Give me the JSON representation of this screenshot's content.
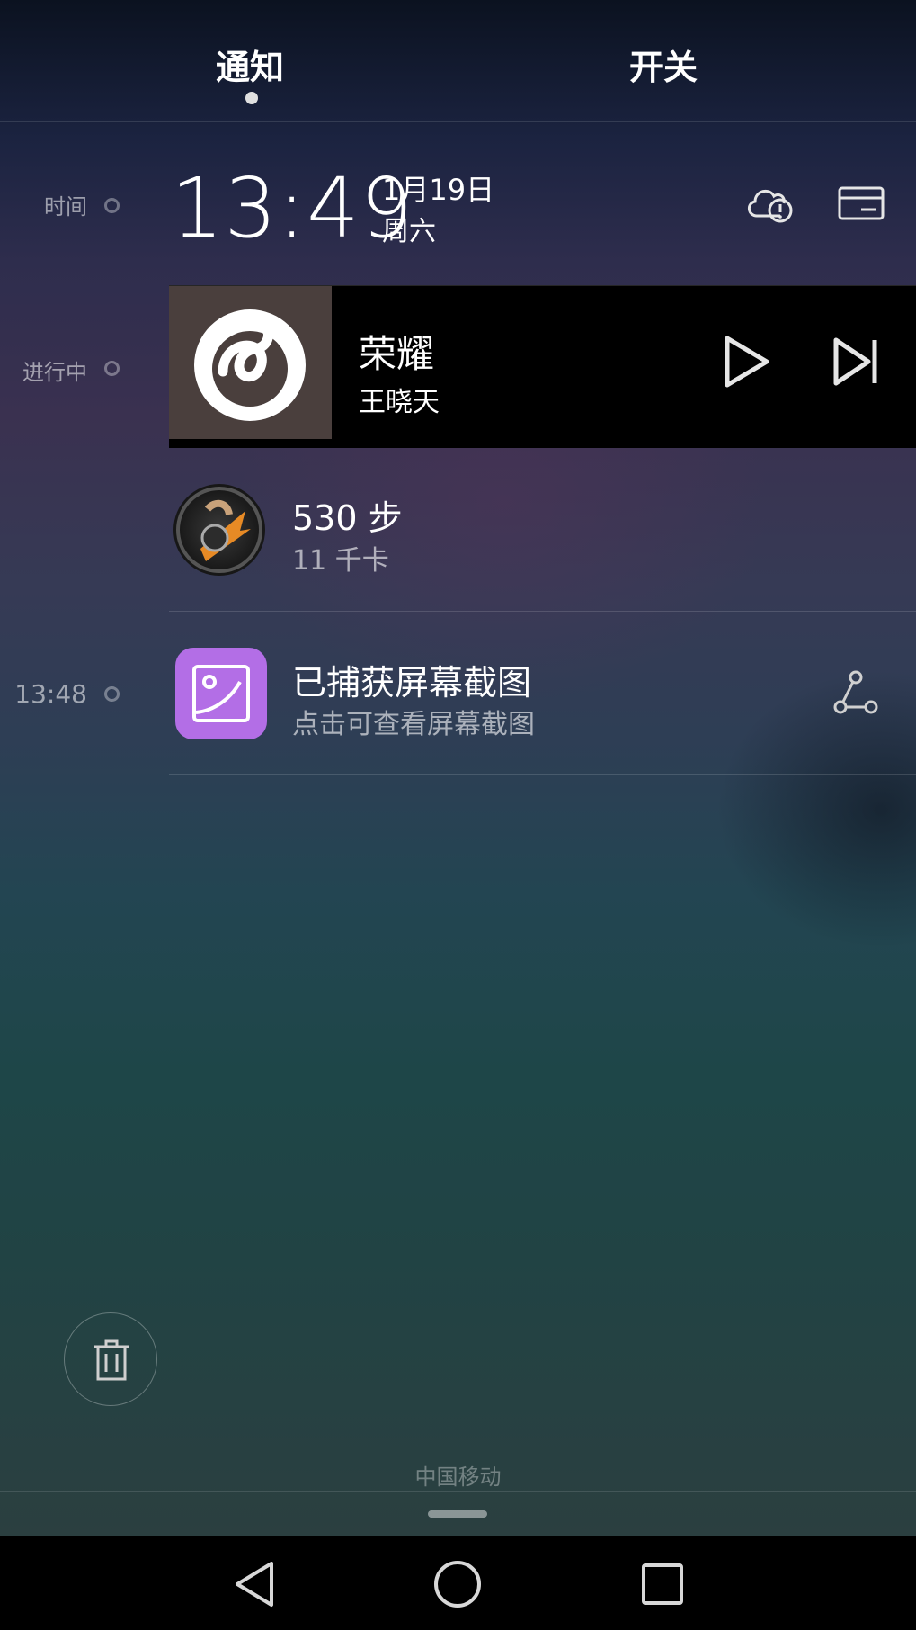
{
  "tabs": {
    "notifications": "通知",
    "switches": "开关"
  },
  "timeline": {
    "time_label": "时间",
    "ongoing_label": "进行中",
    "past_time": "13:48"
  },
  "clock": {
    "time": "13:49",
    "date": "1月19日",
    "weekday": "周六",
    "icons": [
      "cloud-alert-icon",
      "card-icon"
    ]
  },
  "music": {
    "title": "荣耀",
    "artist": "王晓天",
    "app_icon": "netease-music-icon",
    "controls": [
      "play-icon",
      "skip-next-icon"
    ]
  },
  "health": {
    "steps": "530 步",
    "calories": "11 千卡"
  },
  "screenshot": {
    "title": "已捕获屏幕截图",
    "subtitle": "点击可查看屏幕截图",
    "icon": "image-icon",
    "action_icon": "share-icon"
  },
  "footer": {
    "carrier": "中国移动"
  },
  "navbar": {
    "buttons": [
      "back-icon",
      "home-icon",
      "recents-icon"
    ]
  },
  "colors": {
    "screenshot_icon_bg": "#b36ee6",
    "music_card_bg": "#000000"
  }
}
